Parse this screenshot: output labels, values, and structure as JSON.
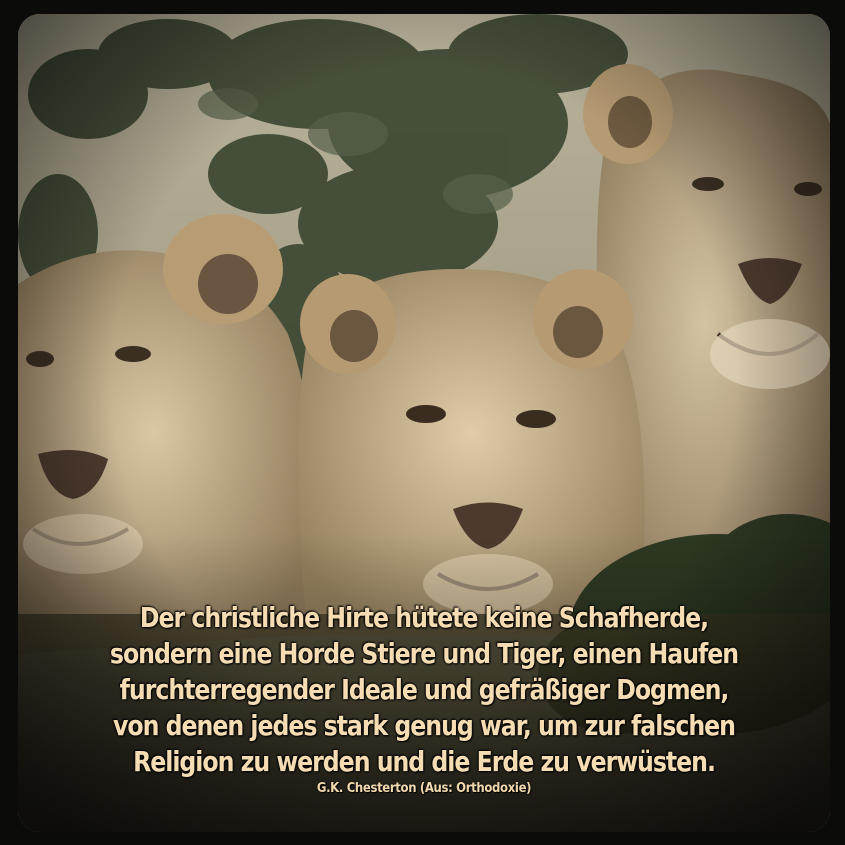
{
  "image": {
    "subject": "lions",
    "colors": {
      "frame": "#0b0b09",
      "text": "#f6dcb2",
      "fur": "#c8b28c",
      "foliage": "#2f3a26"
    }
  },
  "quote": {
    "text": "Der christliche Hirte hütete keine Schafherde,\nsondern eine Horde Stiere und Tiger, einen Haufen\nfurchterregender Ideale und gefräßiger Dogmen,\nvon denen jedes stark genug war, um zur falschen\nReligion zu werden und die Erde zu verwüsten.",
    "author": "G.K. Chesterton (Aus: Orthodoxie)"
  }
}
